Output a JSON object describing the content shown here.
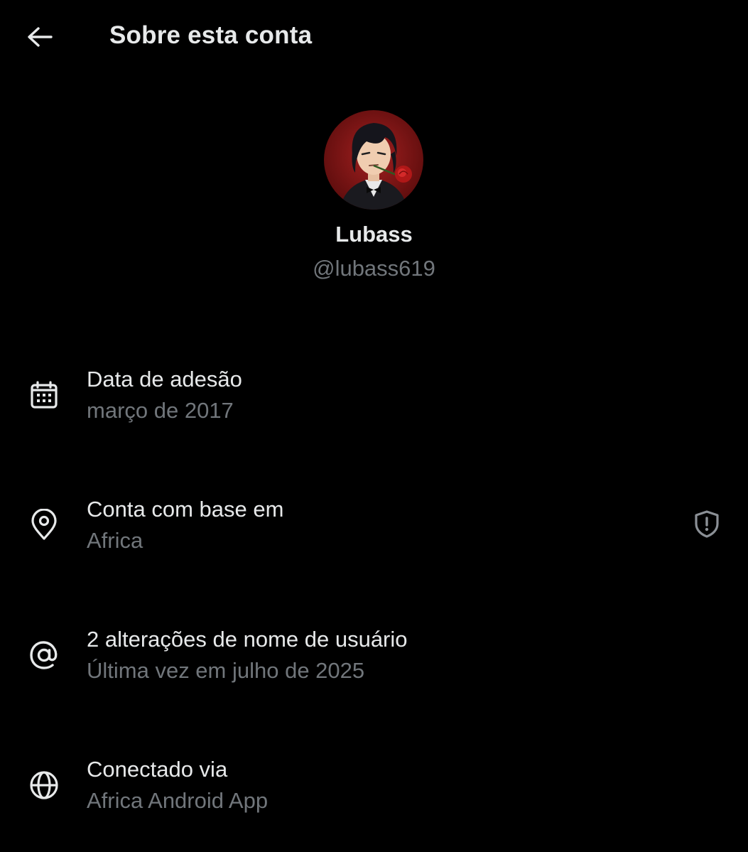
{
  "header": {
    "title": "Sobre esta conta",
    "back_icon": "arrow-left-icon"
  },
  "profile": {
    "display_name": "Lubass",
    "handle": "@lubass619",
    "avatar_bg": "#8b1a1a"
  },
  "info_rows": [
    {
      "icon": "calendar-icon",
      "title": "Data de adesão",
      "subtitle": "março de 2017"
    },
    {
      "icon": "location-pin-icon",
      "title": "Conta com base em",
      "subtitle": "Africa",
      "trailing_icon": "shield-alert-icon"
    },
    {
      "icon": "at-sign-icon",
      "title": "2 alterações de nome de usuário",
      "subtitle": "Última vez em julho de 2025"
    },
    {
      "icon": "globe-icon",
      "title": "Conectado via",
      "subtitle": "Africa Android App"
    }
  ],
  "colors": {
    "background": "#000000",
    "primary_text": "#e7e9ea",
    "secondary_text": "#71767b"
  }
}
